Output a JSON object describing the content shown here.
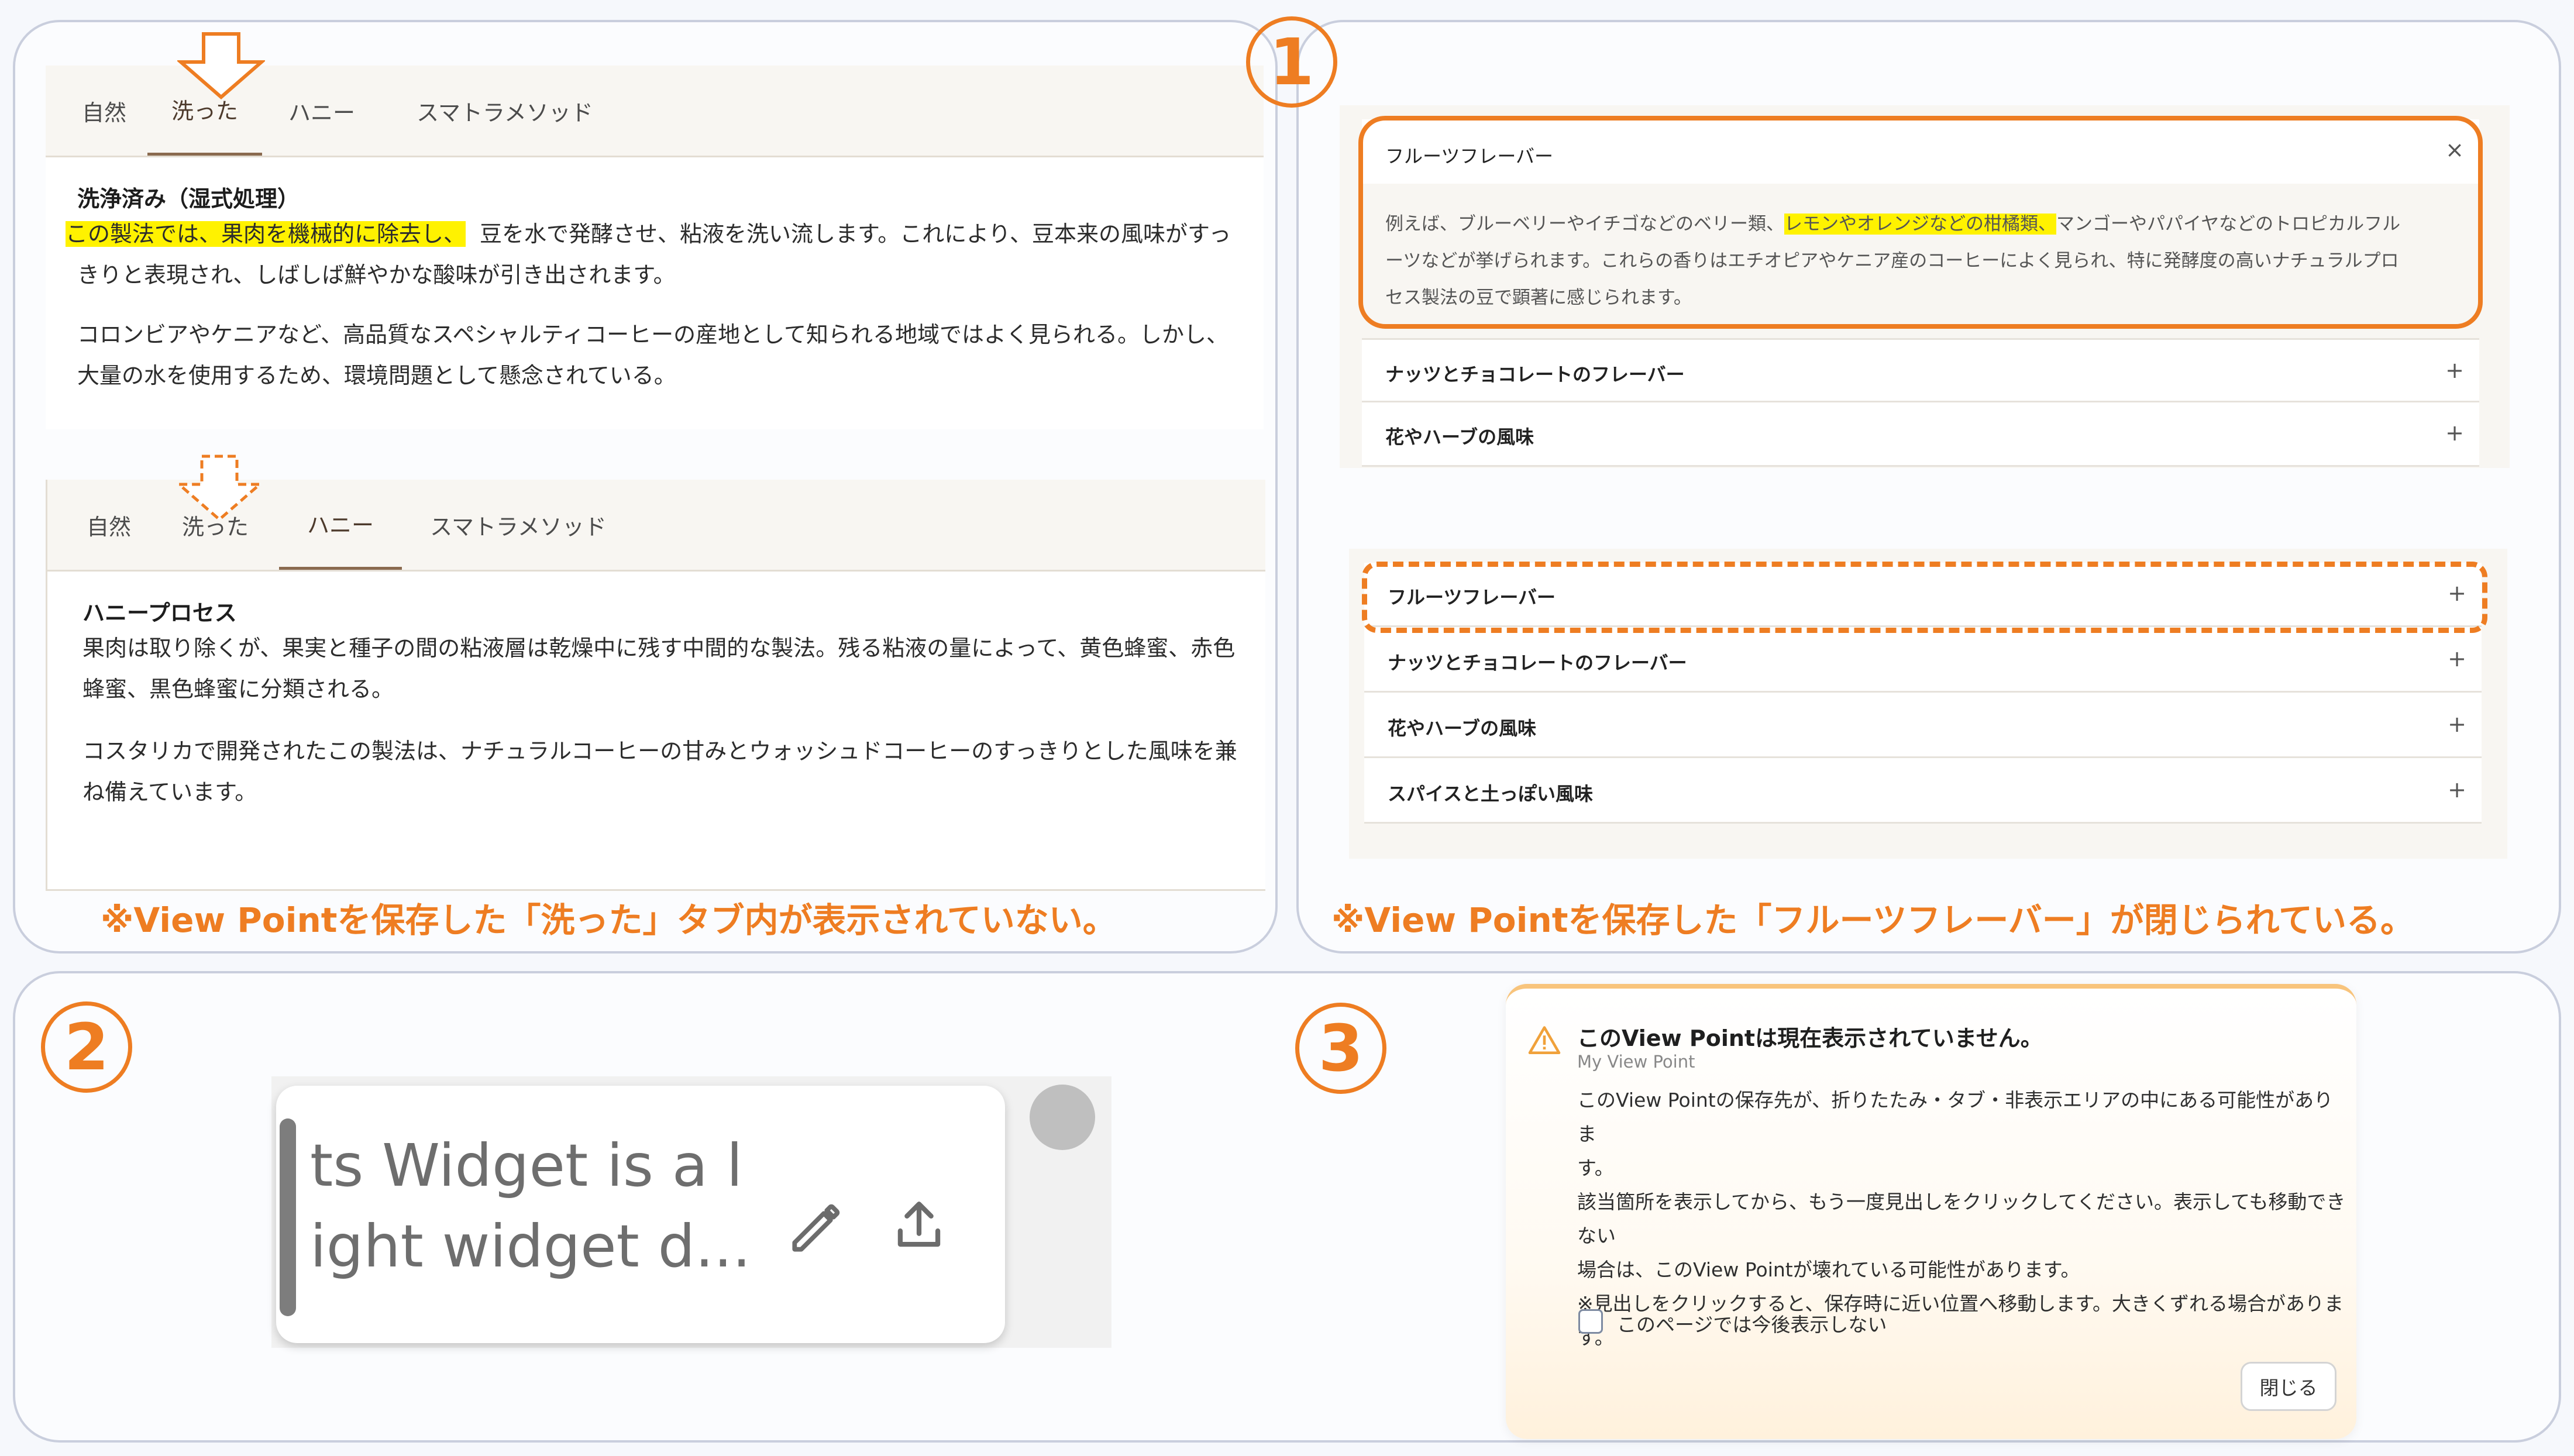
{
  "panel1_left": {
    "top_tabs": [
      "自然",
      "洗った",
      "ハニー",
      "スマトラメソッド"
    ],
    "top_active_tab": "洗った",
    "washed": {
      "title": "洗浄済み（湿式処理）",
      "highlight": "この製法では、果肉を機械的に除去し、",
      "line1_rest": "豆を水で発酵させ、粘液を洗い流します。これにより、豆本来の風味がすっ",
      "line2": "きりと表現され、しばしば鮮やかな酸味が引き出されます。",
      "para2_line1": "コロンビアやケニアなど、高品質なスペシャルティコーヒーの産地として知られる地域ではよく見られる。しかし、",
      "para2_line2": "大量の水を使用するため、環境問題として懸念されている。"
    },
    "bottom_tabs": [
      "自然",
      "洗った",
      "ハニー",
      "スマトラメソッド"
    ],
    "bottom_active_tab": "ハニー",
    "honey": {
      "title": "ハニープロセス",
      "para1_line1": "果肉は取り除くが、果実と種子の間の粘液層は乾燥中に残す中間的な製法。残る粘液の量によって、黄色蜂蜜、赤色",
      "para1_line2": "蜂蜜、黒色蜂蜜に分類される。",
      "para2_line1": "コスタリカで開発されたこの製法は、ナチュラルコーヒーの甘みとウォッシュドコーヒーのすっきりとした風味を兼",
      "para2_line2": "ね備えています。"
    },
    "caption": "※View Pointを保存した「洗った」タブ内が表示されていない。"
  },
  "panel1_right": {
    "number": "1",
    "top_accordion": {
      "open_item": {
        "label": "フルーツフレーバー",
        "close_sign": "×",
        "line1_pre": "例えば、ブルーベリーやイチゴなどのベリー類、",
        "line1_highlight": "レモンやオレンジなどの柑橘類、",
        "line1_post": "マンゴーやパパイヤなどのトロピカルフル",
        "line2": "ーツなどが挙げられます。これらの香りはエチオピアやケニア産のコーヒーによく見られ、特に発酵度の高いナチュラルプロ",
        "line3": "セス製法の豆で顕著に感じられます。"
      },
      "items": [
        {
          "label": "ナッツとチョコレートのフレーバー",
          "sign": "+"
        },
        {
          "label": "花やハーブの風味",
          "sign": "+"
        }
      ]
    },
    "bottom_accordion": {
      "items": [
        {
          "label": "フルーツフレーバー",
          "sign": "+"
        },
        {
          "label": "ナッツとチョコレートのフレーバー",
          "sign": "+"
        },
        {
          "label": "花やハーブの風味",
          "sign": "+"
        },
        {
          "label": "スパイスと土っぽい風味",
          "sign": "+"
        }
      ]
    },
    "caption": "※View Pointを保存した「フルーツフレーバー」が閉じられている。"
  },
  "panel2": {
    "number": "2",
    "widget_text": "ts Widget is a l\night widget d...",
    "edit_icon": "pencil-icon",
    "share_icon": "upload-icon"
  },
  "panel3": {
    "number": "3",
    "title": "このView Pointは現在表示されていません。",
    "subtitle": "My View Point",
    "body_lines": [
      "このView Pointの保存先が、折りたたみ・タブ・非表示エリアの中にある可能性がありま",
      "す。",
      "該当箇所を表示してから、もう一度見出しをクリックしてください。表示しても移動できない",
      "場合は、このView Pointが壊れている可能性があります。",
      "※見出しをクリックすると、保存時に近い位置へ移動します。大きくずれる場合がありま",
      "す。"
    ],
    "checkbox_label": "このページでは今後表示しない",
    "close_button": "閉じる",
    "warning_icon": "warning-icon"
  },
  "colors": {
    "accent_orange": "#ee7d22",
    "highlight_yellow": "#fff200",
    "tab_active": "#8a6a4f"
  }
}
